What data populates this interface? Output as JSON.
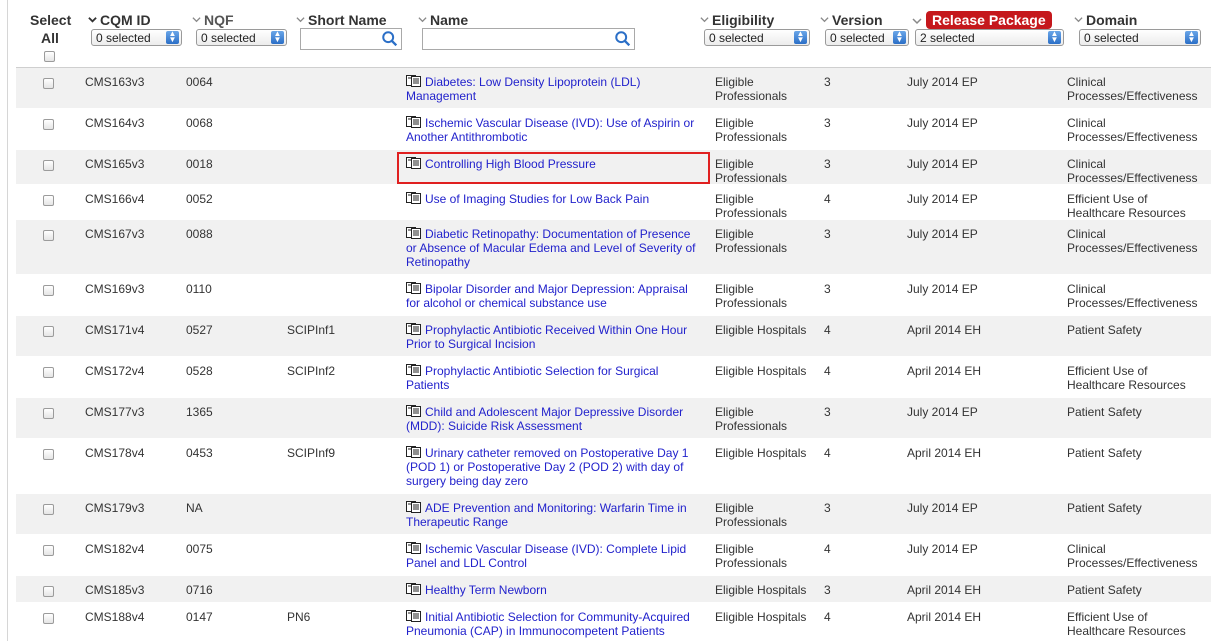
{
  "header": {
    "select_all": "Select",
    "select_all_2": "All",
    "cqm_id": "CQM ID",
    "nqf": "NQF",
    "short_name": "Short Name",
    "name": "Name",
    "eligibility": "Eligibility",
    "version": "Version",
    "release_package": "Release Package",
    "domain": "Domain"
  },
  "filters": {
    "cqm_id": "0 selected",
    "nqf": "0 selected",
    "eligibility": "0 selected",
    "version": "0 selected",
    "release_package": "2 selected",
    "domain": "0 selected",
    "short_name_search": "",
    "name_search": ""
  },
  "colors": {
    "link": "#2222cc",
    "badge": "#c5181c",
    "highlight": "#e02020",
    "row_alt": "#f1f1f1"
  },
  "icons": [
    "chevron-down-icon",
    "search-icon",
    "document-icon",
    "checkbox"
  ],
  "rows": [
    {
      "cqm": "CMS163v3",
      "nqf": "0064",
      "short": "",
      "name": "Diabetes: Low Density Lipoprotein (LDL) Management",
      "elig": "Eligible Professionals",
      "ver": "3",
      "pkg": "July 2014 EP",
      "domain": "Clinical Processes/Effectiveness"
    },
    {
      "cqm": "CMS164v3",
      "nqf": "0068",
      "short": "",
      "name": "Ischemic Vascular Disease (IVD): Use of Aspirin or Another Antithrombotic",
      "elig": "Eligible Professionals",
      "ver": "3",
      "pkg": "July 2014 EP",
      "domain": "Clinical Processes/Effectiveness"
    },
    {
      "cqm": "CMS165v3",
      "nqf": "0018",
      "short": "",
      "name": "Controlling High Blood Pressure",
      "elig": "Eligible Professionals",
      "ver": "3",
      "pkg": "July 2014 EP",
      "domain": "Clinical Processes/Effectiveness"
    },
    {
      "cqm": "CMS166v4",
      "nqf": "0052",
      "short": "",
      "name": "Use of Imaging Studies for Low Back Pain",
      "elig": "Eligible Professionals",
      "ver": "4",
      "pkg": "July 2014 EP",
      "domain": "Efficient Use of Healthcare Resources"
    },
    {
      "cqm": "CMS167v3",
      "nqf": "0088",
      "short": "",
      "name": "Diabetic Retinopathy: Documentation of Presence or Absence of Macular Edema and Level of Severity of Retinopathy",
      "elig": "Eligible Professionals",
      "ver": "3",
      "pkg": "July 2014 EP",
      "domain": "Clinical Processes/Effectiveness"
    },
    {
      "cqm": "CMS169v3",
      "nqf": "0110",
      "short": "",
      "name": "Bipolar Disorder and Major Depression: Appraisal for alcohol or chemical substance use",
      "elig": "Eligible Professionals",
      "ver": "3",
      "pkg": "July 2014 EP",
      "domain": "Clinical Processes/Effectiveness"
    },
    {
      "cqm": "CMS171v4",
      "nqf": "0527",
      "short": "SCIPInf1",
      "name": "Prophylactic Antibiotic Received Within One Hour Prior to Surgical Incision",
      "elig": "Eligible Hospitals",
      "ver": "4",
      "pkg": "April 2014 EH",
      "domain": "Patient Safety"
    },
    {
      "cqm": "CMS172v4",
      "nqf": "0528",
      "short": "SCIPInf2",
      "name": "Prophylactic Antibiotic Selection for Surgical Patients",
      "elig": "Eligible Hospitals",
      "ver": "4",
      "pkg": "April 2014 EH",
      "domain": "Efficient Use of Healthcare Resources"
    },
    {
      "cqm": "CMS177v3",
      "nqf": "1365",
      "short": "",
      "name": "Child and Adolescent Major Depressive Disorder (MDD): Suicide Risk Assessment",
      "elig": "Eligible Professionals",
      "ver": "3",
      "pkg": "July 2014 EP",
      "domain": "Patient Safety"
    },
    {
      "cqm": "CMS178v4",
      "nqf": "0453",
      "short": "SCIPInf9",
      "name": "Urinary catheter removed on Postoperative Day 1 (POD 1) or Postoperative Day 2 (POD 2) with day of surgery being day zero",
      "elig": "Eligible Hospitals",
      "ver": "4",
      "pkg": "April 2014 EH",
      "domain": "Patient Safety"
    },
    {
      "cqm": "CMS179v3",
      "nqf": "NA",
      "short": "",
      "name": "ADE Prevention and Monitoring: Warfarin Time in Therapeutic Range",
      "elig": "Eligible Professionals",
      "ver": "3",
      "pkg": "July 2014 EP",
      "domain": "Patient Safety"
    },
    {
      "cqm": "CMS182v4",
      "nqf": "0075",
      "short": "",
      "name": "Ischemic Vascular Disease (IVD): Complete Lipid Panel and LDL Control",
      "elig": "Eligible Professionals",
      "ver": "4",
      "pkg": "July 2014 EP",
      "domain": "Clinical Processes/Effectiveness"
    },
    {
      "cqm": "CMS185v3",
      "nqf": "0716",
      "short": "",
      "name": "Healthy Term Newborn",
      "elig": "Eligible Hospitals",
      "ver": "3",
      "pkg": "April 2014 EH",
      "domain": "Patient Safety"
    },
    {
      "cqm": "CMS188v4",
      "nqf": "0147",
      "short": "PN6",
      "name": "Initial Antibiotic Selection for Community-Acquired Pneumonia (CAP) in Immunocompetent Patients",
      "elig": "Eligible Hospitals",
      "ver": "4",
      "pkg": "April 2014 EH",
      "domain": "Efficient Use of Healthcare Resources"
    }
  ]
}
